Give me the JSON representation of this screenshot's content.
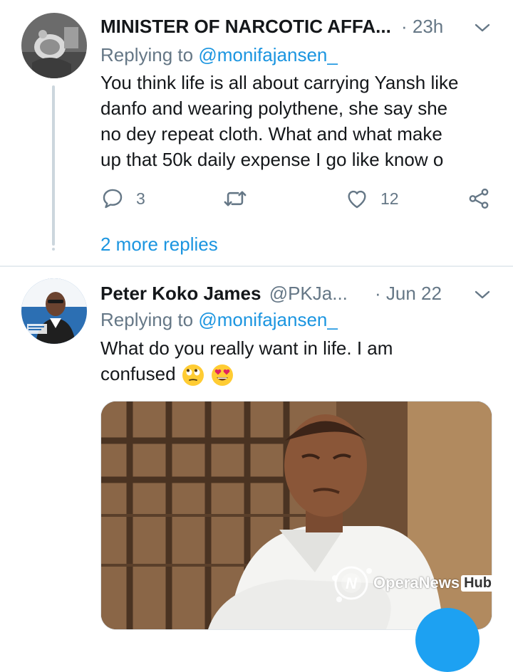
{
  "tweet1": {
    "author_name": "MINISTER OF NARCOTIC AFFA...",
    "time": "· 23h",
    "replying_prefix": "Replying to ",
    "replying_handle": "@monifajansen_",
    "text_lines": [
      "You think life is all about carrying Yansh like",
      "danfo and wearing polythene, she say she",
      "no dey repeat cloth. What and what make",
      "up that 50k daily expense I go like know o"
    ],
    "reply_count": "3",
    "retweet_count": "",
    "like_count": "12",
    "more_replies": "2 more replies"
  },
  "tweet2": {
    "author_name": "Peter Koko James",
    "author_handle": "@PKJa...",
    "time": "· Jun 22",
    "replying_prefix": "Replying to ",
    "replying_handle": "@monifajansen_",
    "text_line1": "What do you really want in life. I am",
    "text_line2": "confused",
    "emojis": [
      "face-with-rolling-eyes",
      "smiling-face-with-heart-eyes"
    ],
    "media_description": "photo"
  },
  "watermark": {
    "brand": "OperaNews",
    "suffix": "Hub"
  },
  "colors": {
    "link": "#1b95e0",
    "muted": "#657786",
    "text": "#14171a",
    "divider": "#e6ecf0",
    "fab": "#1da1f2"
  }
}
